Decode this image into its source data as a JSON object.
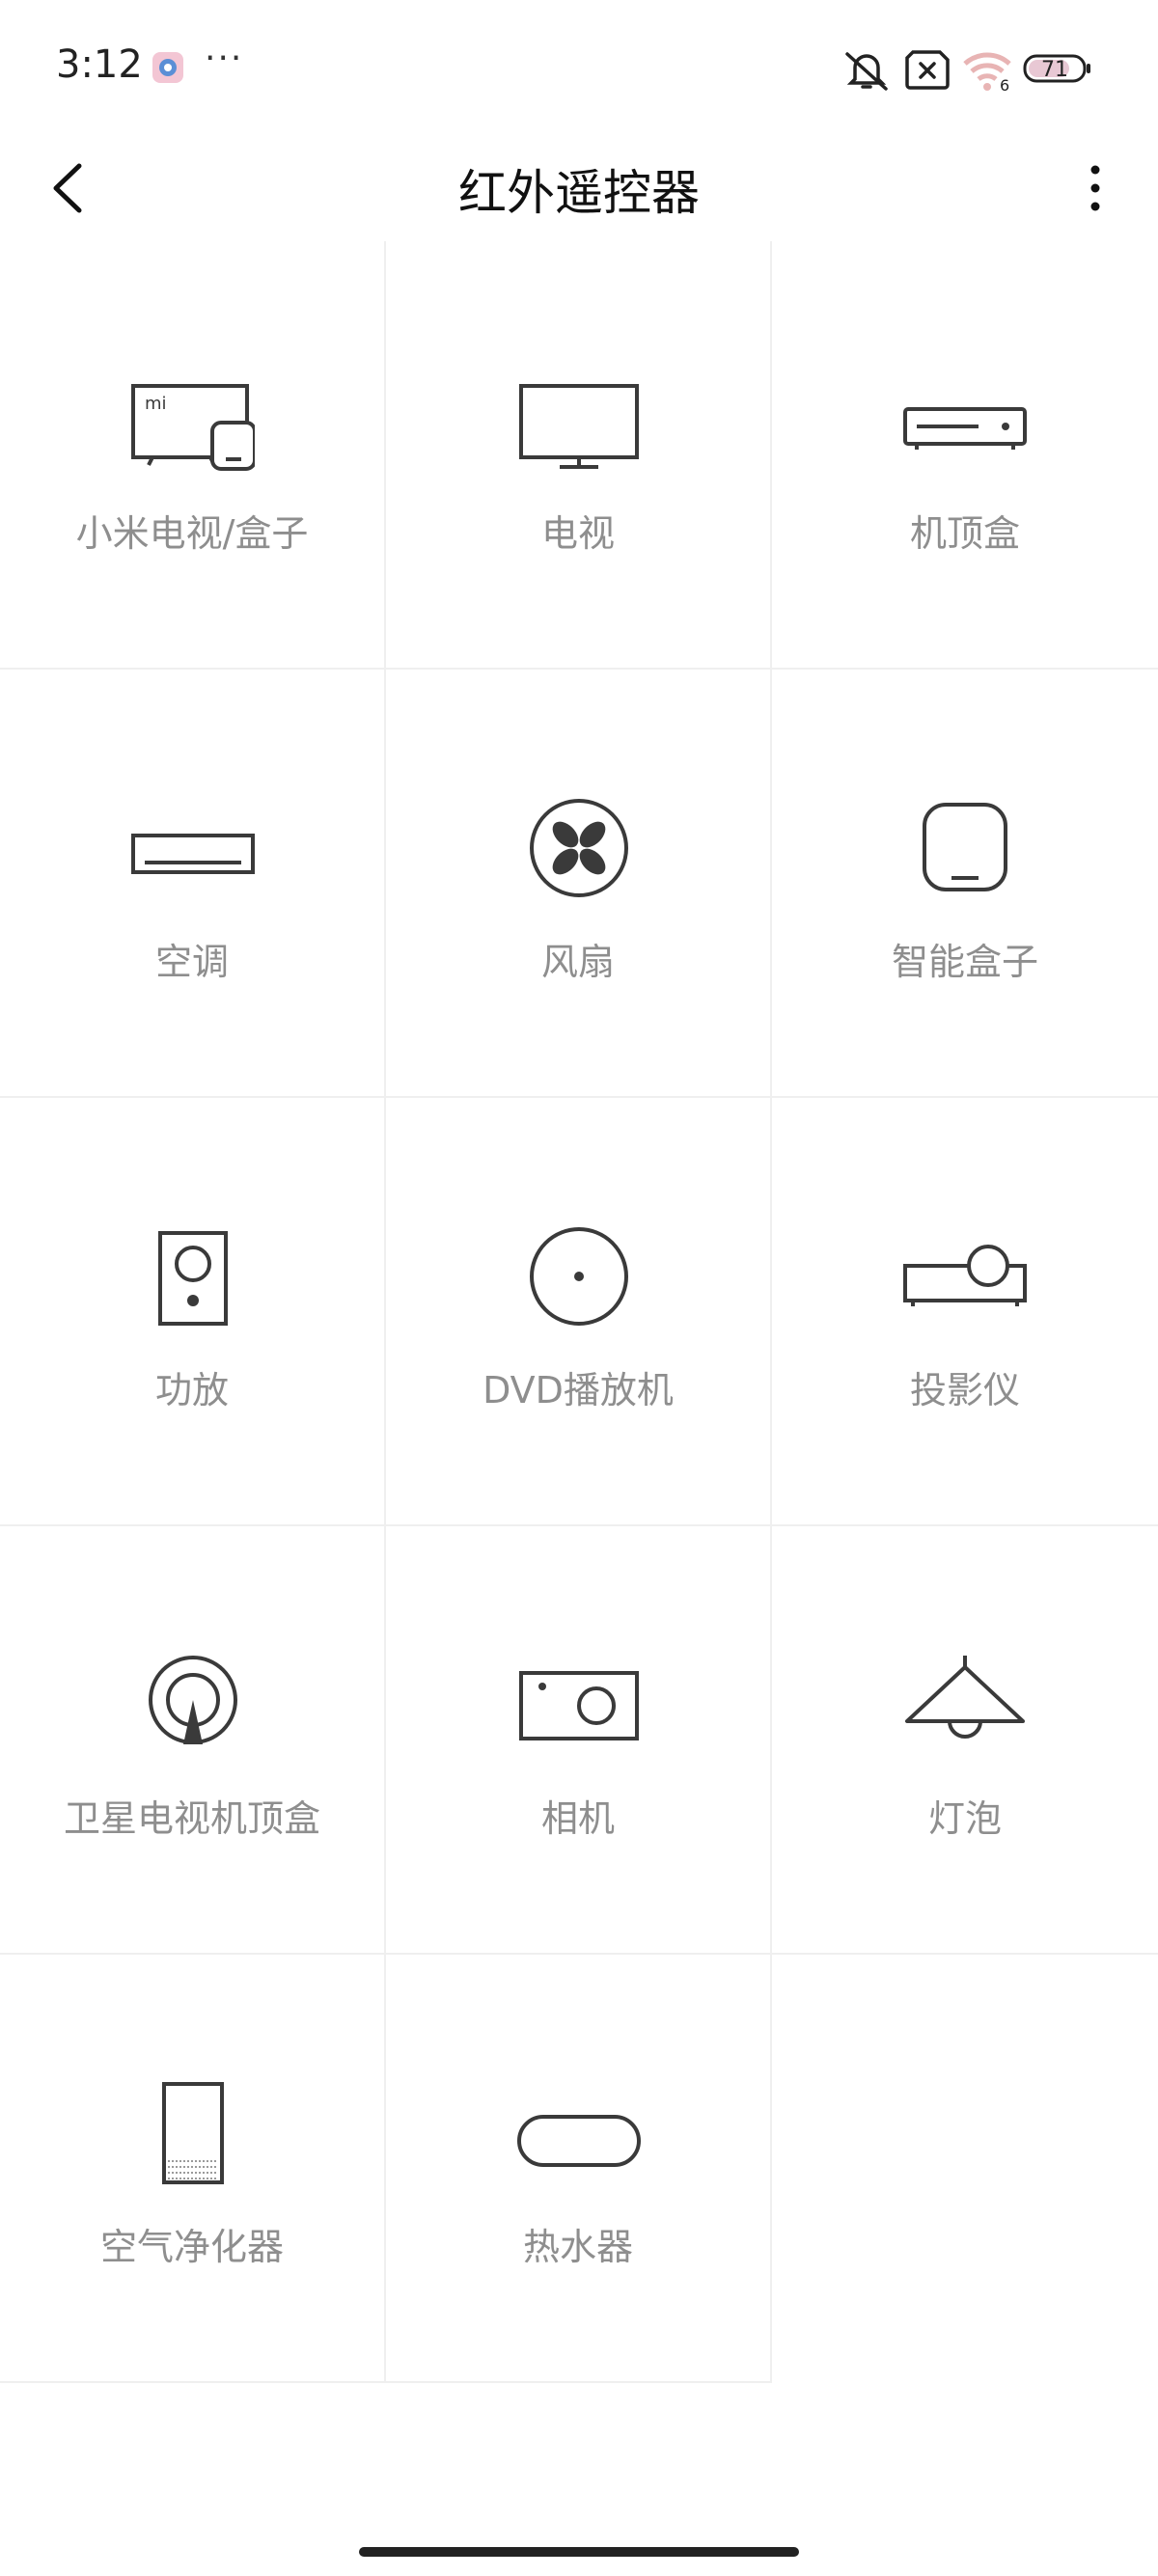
{
  "status_bar": {
    "time": "3:12",
    "more": "···",
    "battery_level": "71",
    "wifi_label": "6"
  },
  "header": {
    "title": "红外遥控器"
  },
  "devices": [
    {
      "label": "小米电视/盒子",
      "icon": "mi-tv-box-icon"
    },
    {
      "label": "电视",
      "icon": "tv-icon"
    },
    {
      "label": "机顶盒",
      "icon": "set-top-box-icon"
    },
    {
      "label": "空调",
      "icon": "air-conditioner-icon"
    },
    {
      "label": "风扇",
      "icon": "fan-icon"
    },
    {
      "label": "智能盒子",
      "icon": "smart-box-icon"
    },
    {
      "label": "功放",
      "icon": "amplifier-icon"
    },
    {
      "label": "DVD播放机",
      "icon": "dvd-player-icon"
    },
    {
      "label": "投影仪",
      "icon": "projector-icon"
    },
    {
      "label": "卫星电视机顶盒",
      "icon": "satellite-icon"
    },
    {
      "label": "相机",
      "icon": "camera-icon"
    },
    {
      "label": "灯泡",
      "icon": "lamp-icon"
    },
    {
      "label": "空气净化器",
      "icon": "air-purifier-icon"
    },
    {
      "label": "热水器",
      "icon": "water-heater-icon"
    }
  ],
  "colors": {
    "icon_stroke": "#3a3a3a",
    "label": "#8e8e8e",
    "divider": "#efefef"
  }
}
